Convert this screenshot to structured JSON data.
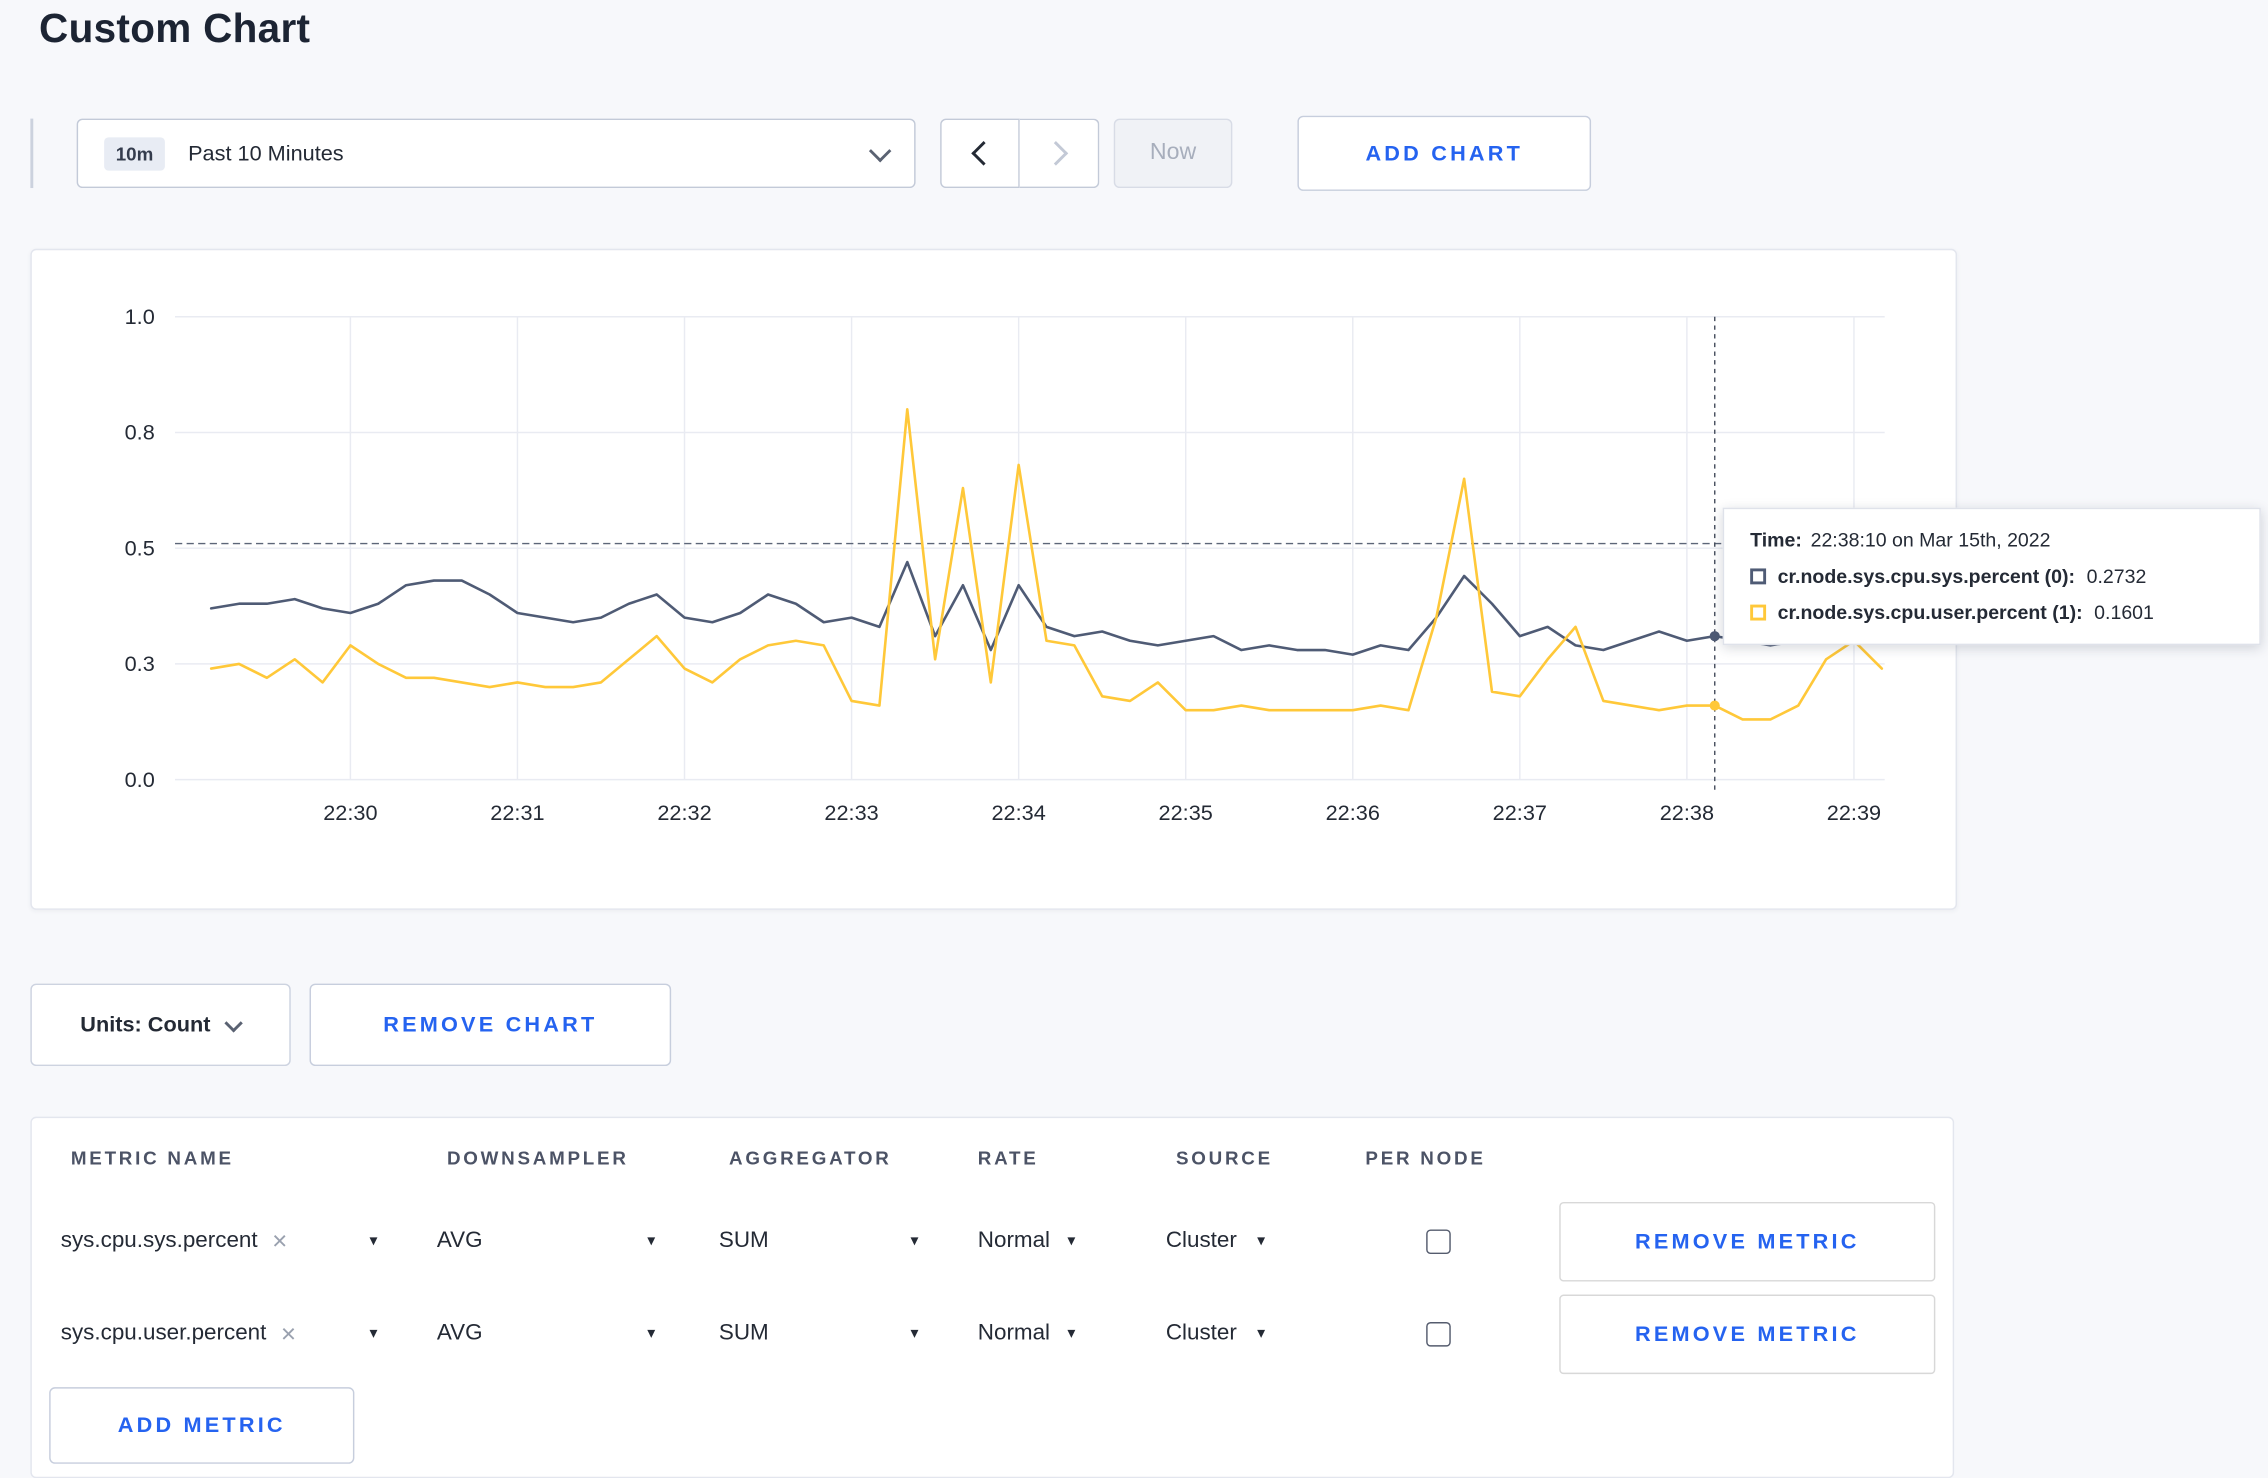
{
  "page": {
    "title": "Custom Chart"
  },
  "toolbar": {
    "range_badge": "10m",
    "range_label": "Past 10 Minutes",
    "now_label": "Now",
    "add_chart_label": "ADD CHART"
  },
  "icons": {
    "clear": "×",
    "caret": "▾"
  },
  "colors": {
    "accent": "#2563f0",
    "series_sys": "#4f5b75",
    "series_user": "#ffc839",
    "page_bg": "#f7f8fb"
  },
  "chart_data": {
    "type": "line",
    "title": "",
    "xlabel": "",
    "ylabel": "",
    "ylim": [
      0,
      1
    ],
    "grid": true,
    "x_ticks": [
      "22:30",
      "22:31",
      "22:32",
      "22:33",
      "22:34",
      "22:35",
      "22:36",
      "22:37",
      "22:38",
      "22:39"
    ],
    "y_ticks": [
      {
        "v": 1.0,
        "label": "1.0"
      },
      {
        "v": 0.75,
        "label": "0.8"
      },
      {
        "v": 0.5,
        "label": "0.5"
      },
      {
        "v": 0.25,
        "label": "0.3"
      },
      {
        "v": 0.0,
        "label": "0.0"
      }
    ],
    "threshold": 0.51,
    "crosshair_index": 54,
    "crosshair_time": "22:38:10",
    "series": [
      {
        "name": "cr.node.sys.cpu.sys.percent",
        "color": "#4f5b75",
        "values": [
          0.37,
          0.38,
          0.38,
          0.39,
          0.37,
          0.36,
          0.38,
          0.42,
          0.43,
          0.43,
          0.4,
          0.36,
          0.35,
          0.34,
          0.35,
          0.38,
          0.4,
          0.35,
          0.34,
          0.36,
          0.4,
          0.38,
          0.34,
          0.35,
          0.33,
          0.47,
          0.31,
          0.42,
          0.28,
          0.42,
          0.33,
          0.31,
          0.32,
          0.3,
          0.29,
          0.3,
          0.31,
          0.28,
          0.29,
          0.28,
          0.28,
          0.27,
          0.29,
          0.28,
          0.35,
          0.44,
          0.38,
          0.31,
          0.33,
          0.29,
          0.28,
          0.3,
          0.32,
          0.3,
          0.31,
          0.3,
          0.29,
          0.3,
          0.31,
          0.3,
          0.31
        ]
      },
      {
        "name": "cr.node.sys.cpu.user.percent",
        "color": "#ffc839",
        "values": [
          0.24,
          0.25,
          0.22,
          0.26,
          0.21,
          0.29,
          0.25,
          0.22,
          0.22,
          0.21,
          0.2,
          0.21,
          0.2,
          0.2,
          0.21,
          0.26,
          0.31,
          0.24,
          0.21,
          0.26,
          0.29,
          0.3,
          0.29,
          0.17,
          0.16,
          0.8,
          0.26,
          0.63,
          0.21,
          0.68,
          0.3,
          0.29,
          0.18,
          0.17,
          0.21,
          0.15,
          0.15,
          0.16,
          0.15,
          0.15,
          0.15,
          0.15,
          0.16,
          0.15,
          0.35,
          0.65,
          0.19,
          0.18,
          0.26,
          0.33,
          0.17,
          0.16,
          0.15,
          0.16,
          0.16,
          0.13,
          0.13,
          0.16,
          0.26,
          0.3,
          0.24
        ]
      }
    ]
  },
  "tooltip": {
    "time_label": "Time:",
    "time_value": "22:38:10 on Mar 15th, 2022",
    "entries": [
      {
        "label": "cr.node.sys.cpu.sys.percent (0):",
        "value": "0.2732"
      },
      {
        "label": "cr.node.sys.cpu.user.percent (1):",
        "value": "0.1601"
      }
    ]
  },
  "chart_footer": {
    "units_label": "Units: Count",
    "remove_chart_label": "REMOVE CHART"
  },
  "metrics_table": {
    "headers": [
      "METRIC NAME",
      "DOWNSAMPLER",
      "AGGREGATOR",
      "RATE",
      "SOURCE",
      "PER NODE"
    ],
    "rows": [
      {
        "metric": "sys.cpu.sys.percent",
        "downsampler": "AVG",
        "aggregator": "SUM",
        "rate": "Normal",
        "source": "Cluster",
        "per_node": false,
        "remove_label": "REMOVE METRIC"
      },
      {
        "metric": "sys.cpu.user.percent",
        "downsampler": "AVG",
        "aggregator": "SUM",
        "rate": "Normal",
        "source": "Cluster",
        "per_node": false,
        "remove_label": "REMOVE METRIC"
      }
    ],
    "add_metric_label": "ADD METRIC"
  }
}
